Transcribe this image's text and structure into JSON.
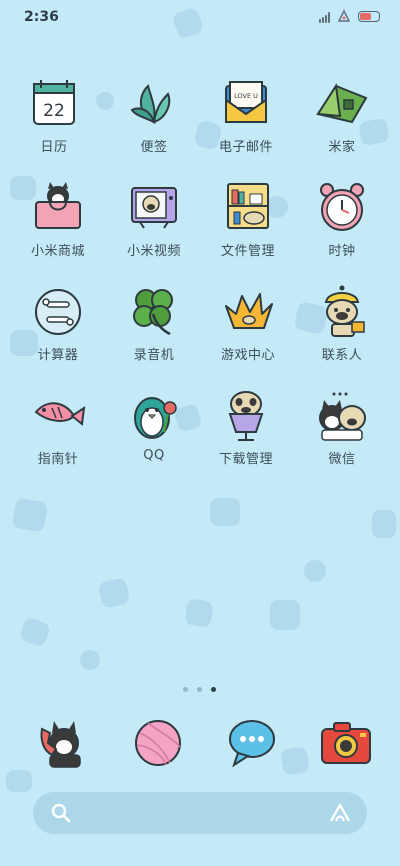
{
  "status_bar": {
    "time": "2:36",
    "battery_level": 0.62,
    "icons": [
      "signal-icon",
      "network-icon",
      "battery-icon"
    ]
  },
  "apps": [
    {
      "label": "日历",
      "icon": "calendar-icon",
      "day": "22"
    },
    {
      "label": "便签",
      "icon": "notes-leaf-icon"
    },
    {
      "label": "电子邮件",
      "icon": "email-icon",
      "badge_text": "LOVE U"
    },
    {
      "label": "米家",
      "icon": "tent-icon"
    },
    {
      "label": "小米商城",
      "icon": "shopping-bag-cat-icon"
    },
    {
      "label": "小米视频",
      "icon": "tv-dog-icon"
    },
    {
      "label": "文件管理",
      "icon": "bookshelf-icon"
    },
    {
      "label": "时钟",
      "icon": "alarm-clock-icon"
    },
    {
      "label": "计算器",
      "icon": "calculator-bone-icon"
    },
    {
      "label": "录音机",
      "icon": "clover-icon"
    },
    {
      "label": "游戏中心",
      "icon": "crown-icon"
    },
    {
      "label": "联系人",
      "icon": "dog-hat-icon"
    },
    {
      "label": "指南针",
      "icon": "fish-icon"
    },
    {
      "label": "QQ",
      "icon": "penguin-icon"
    },
    {
      "label": "下载管理",
      "icon": "dog-cup-icon"
    },
    {
      "label": "微信",
      "icon": "cat-dog-chat-icon"
    }
  ],
  "page_indicator": {
    "pages": 3,
    "current": 3
  },
  "dock": [
    {
      "name": "phone-cat-icon"
    },
    {
      "name": "yarn-ball-icon"
    },
    {
      "name": "chat-bubble-icon"
    },
    {
      "name": "camera-icon"
    }
  ],
  "search_bar": {
    "search_icon": "search-icon",
    "assistant_icon": "assistant-icon"
  },
  "colors": {
    "background": "#c4e9f7",
    "label": "#3d4e59",
    "accent": "#4fb3a0"
  }
}
